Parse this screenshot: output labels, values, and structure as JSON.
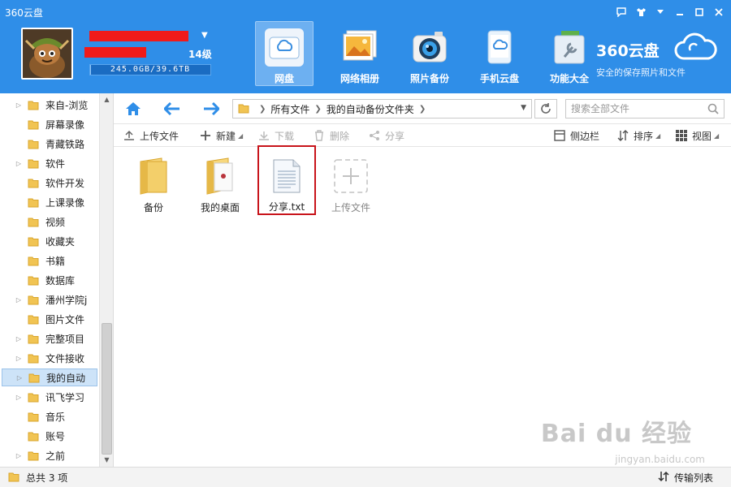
{
  "window": {
    "title": "360云盘",
    "controls": [
      "feedback-icon",
      "skin-icon",
      "menu-icon",
      "minimize-icon",
      "maximize-icon",
      "close-icon"
    ]
  },
  "user": {
    "level": "14级",
    "storage_text": "245.0GB/39.6TB",
    "storage_used_fraction": 0.006
  },
  "nav": {
    "items": [
      {
        "label": "网盘",
        "icon": "cloud-drive-icon",
        "active": true
      },
      {
        "label": "网络相册",
        "icon": "photo-album-icon",
        "active": false
      },
      {
        "label": "照片备份",
        "icon": "camera-icon",
        "active": false
      },
      {
        "label": "手机云盘",
        "icon": "phone-cloud-icon",
        "active": false
      },
      {
        "label": "功能大全",
        "icon": "toolbox-icon",
        "active": false
      }
    ]
  },
  "brand": {
    "name": "360云盘",
    "tagline": "安全的保存照片和文件"
  },
  "sidebar": {
    "items": [
      {
        "label": "来自-浏览",
        "expandable": true,
        "selected": false
      },
      {
        "label": "屏幕录像",
        "expandable": false,
        "selected": false
      },
      {
        "label": "青藏铁路",
        "expandable": false,
        "selected": false
      },
      {
        "label": "软件",
        "expandable": true,
        "selected": false
      },
      {
        "label": "软件开发",
        "expandable": false,
        "selected": false
      },
      {
        "label": "上课录像",
        "expandable": false,
        "selected": false
      },
      {
        "label": "视频",
        "expandable": false,
        "selected": false
      },
      {
        "label": "收藏夹",
        "expandable": false,
        "selected": false
      },
      {
        "label": "书籍",
        "expandable": false,
        "selected": false
      },
      {
        "label": "数据库",
        "expandable": false,
        "selected": false
      },
      {
        "label": "潘州学院j",
        "expandable": true,
        "selected": false
      },
      {
        "label": "图片文件",
        "expandable": false,
        "selected": false
      },
      {
        "label": "完整项目",
        "expandable": true,
        "selected": false
      },
      {
        "label": "文件接收",
        "expandable": true,
        "selected": false
      },
      {
        "label": "我的自动",
        "expandable": true,
        "selected": true
      },
      {
        "label": "讯飞学习",
        "expandable": true,
        "selected": false
      },
      {
        "label": "音乐",
        "expandable": false,
        "selected": false
      },
      {
        "label": "账号",
        "expandable": false,
        "selected": false
      },
      {
        "label": "之前",
        "expandable": true,
        "selected": false
      }
    ]
  },
  "addressbar": {
    "breadcrumbs": [
      "所有文件",
      "我的自动备份文件夹"
    ],
    "search_placeholder": "搜索全部文件"
  },
  "toolbar": {
    "upload": "上传文件",
    "new": "新建",
    "download": "下载",
    "delete": "删除",
    "share": "分享",
    "sidebar": "侧边栏",
    "sort": "排序",
    "view": "视图"
  },
  "files": [
    {
      "name": "备份",
      "type": "folder"
    },
    {
      "name": "我的桌面",
      "type": "folder-desktop"
    },
    {
      "name": "分享.txt",
      "type": "txt",
      "highlighted": true
    },
    {
      "name": "上传文件",
      "type": "upload"
    }
  ],
  "status": {
    "total": "总共 3 项",
    "transfer_list": "传输列表"
  },
  "watermark": {
    "brand": "Bai du 经验",
    "url": "jingyan.baidu.com"
  },
  "colors": {
    "header_bg": "#2f8ee8",
    "selection_bg": "#cde3f8",
    "highlight_border": "#c8141b",
    "folder_yellow": "#f1c453",
    "accent_blue": "#2f8ee8"
  }
}
